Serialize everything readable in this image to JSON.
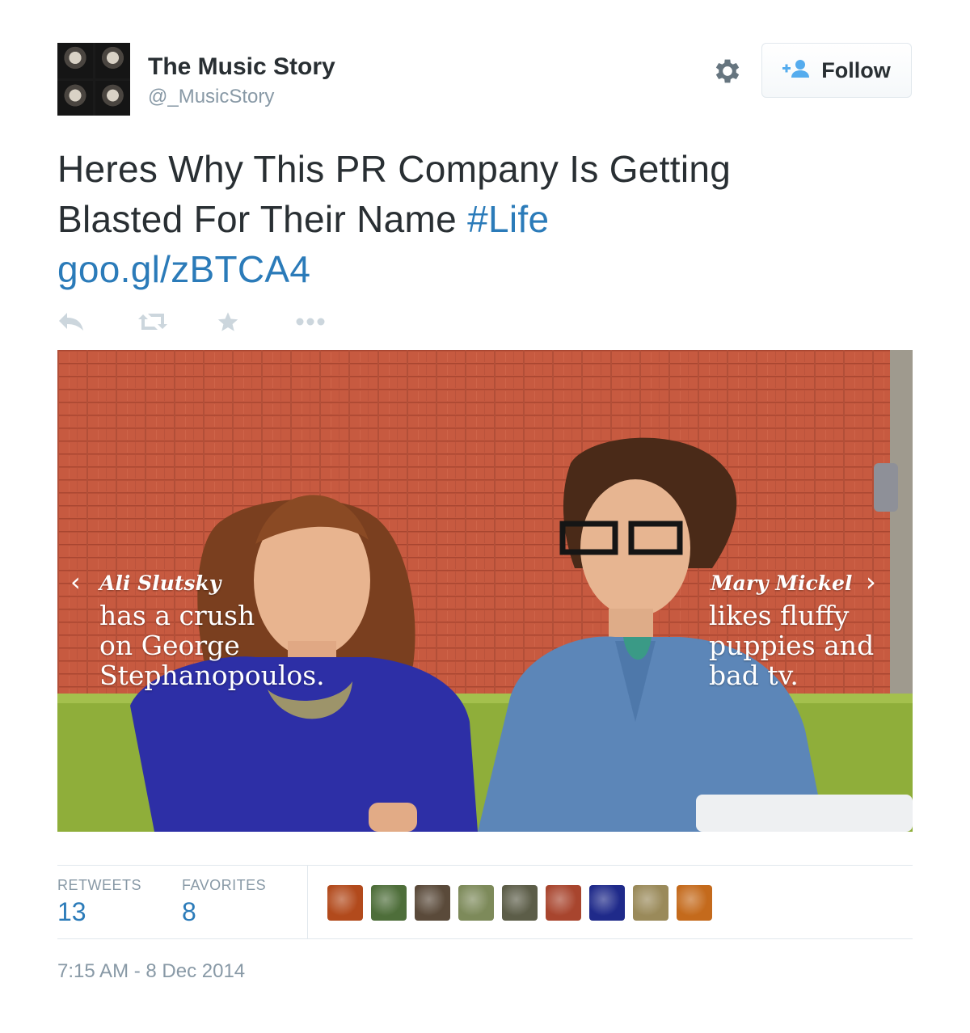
{
  "user": {
    "name": "The Music Story",
    "handle": "@_MusicStory",
    "follow_label": "Follow"
  },
  "tweet": {
    "text_line1": "Heres Why This PR Company Is Getting",
    "text_line2": "Blasted For Their Name ",
    "hashtag": "#Life",
    "link": "goo.gl/zBTCA4"
  },
  "photo": {
    "left_name": "Ali Slutsky",
    "left_desc": [
      "has a crush",
      "on George",
      "Stephanopoulos."
    ],
    "right_name": "Mary Mickel",
    "right_desc": [
      "likes fluffy",
      "puppies and",
      "bad tv."
    ],
    "prev_arrow": "‹",
    "next_arrow": "›"
  },
  "stats": {
    "retweets_label": "RETWEETS",
    "retweets_value": "13",
    "favorites_label": "FAVORITES",
    "favorites_value": "8",
    "favoriter_avatars": [
      "#b24a1c",
      "#4e6e3a",
      "#5a4a3a",
      "#7d8a5a",
      "#5c5d48",
      "#a8452e",
      "#1f2a8a",
      "#9a8a5a",
      "#c46a1c"
    ]
  },
  "timestamp": "7:15 AM - 8 Dec 2014",
  "colors": {
    "link": "#2b7bb9",
    "text": "#292f33",
    "muted": "#8899a6",
    "icon": "#ccd6dd"
  },
  "icons": [
    "gear-icon",
    "follow-person-icon",
    "reply-icon",
    "retweet-icon",
    "favorite-star-icon",
    "more-icon"
  ]
}
